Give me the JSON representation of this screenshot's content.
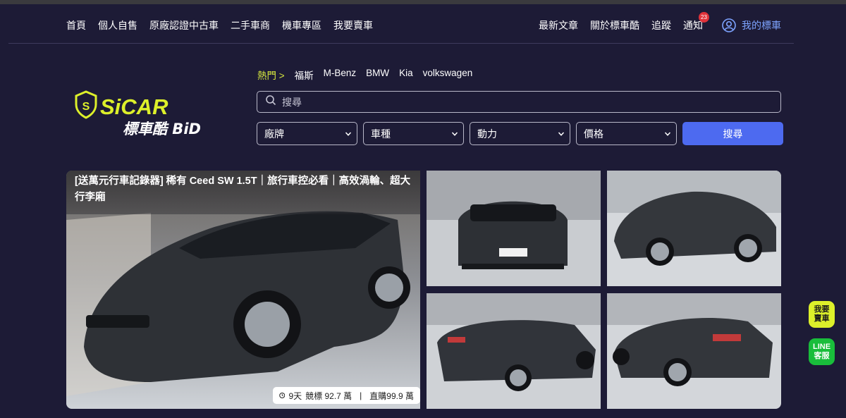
{
  "nav": {
    "left": [
      "首頁",
      "個人自售",
      "原廠認證中古車",
      "二手車商",
      "機車專區",
      "我要賣車"
    ],
    "right": [
      "最新文章",
      "關於標車酷",
      "追蹤",
      "通知"
    ],
    "notify_count": "23",
    "account_label": "我的標車"
  },
  "hot": {
    "label": "熱門 >",
    "tags": [
      "福斯",
      "M-Benz",
      "BMW",
      "Kia",
      "volkswagen"
    ]
  },
  "search": {
    "placeholder": "搜尋"
  },
  "filters": {
    "brand": "廠牌",
    "type": "車種",
    "power": "動力",
    "price": "價格",
    "button": "搜尋"
  },
  "listing": {
    "title": "[送萬元行車記錄器] 稀有 Ceed SW 1.5T｜旅行車控必看｜高效渦輪、超大行李廂",
    "days": "9天",
    "bid": "競標 92.7 萬",
    "separator": "|",
    "buy": "直購99.9 萬"
  },
  "float": {
    "sell_line1": "我要",
    "sell_line2": "賣車",
    "line_line1": "LINE",
    "line_line2": "客服"
  },
  "colors": {
    "background": "#1d1b36",
    "accent_blue": "#4d6af0",
    "accent_yellow": "#d7e83f",
    "line_green": "#19bd3b",
    "badge_red": "#e0323a"
  }
}
